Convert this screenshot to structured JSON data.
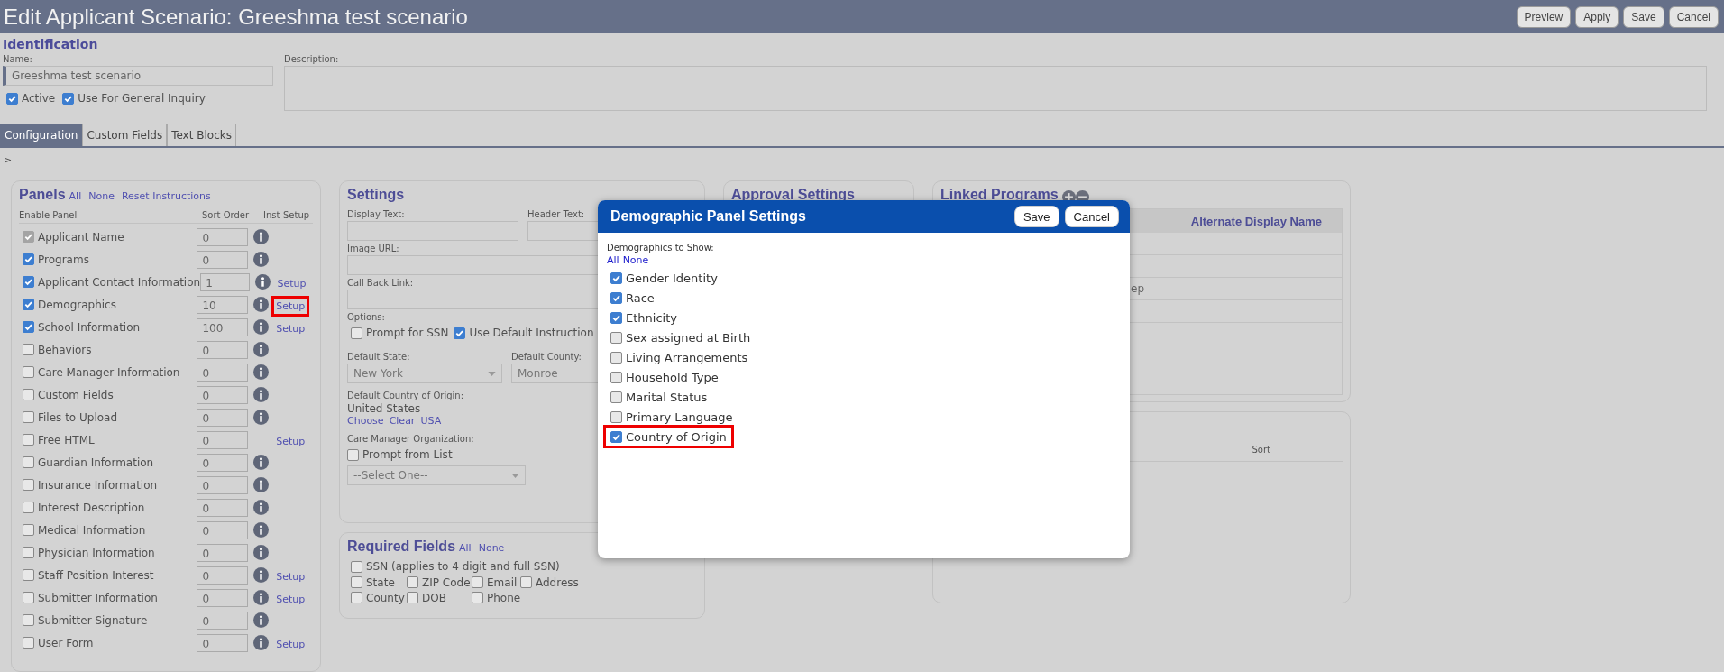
{
  "header": {
    "title": "Edit Applicant Scenario: Greeshma test scenario",
    "buttons": [
      "Preview",
      "Apply",
      "Save",
      "Cancel"
    ]
  },
  "identification": {
    "heading": "Identification",
    "name_label": "Name:",
    "name_value": "Greeshma test scenario",
    "description_label": "Description:",
    "options": [
      {
        "label": "Active",
        "checked": true
      },
      {
        "label": "Use For General Inquiry",
        "checked": true
      }
    ]
  },
  "tabs": [
    {
      "label": "Configuration",
      "selected": true
    },
    {
      "label": "Custom Fields",
      "selected": false
    },
    {
      "label": "Text Blocks",
      "selected": false
    }
  ],
  "breadcrumb": ">",
  "panels": {
    "heading": "Panels",
    "links": [
      "All",
      "None",
      "Reset Instructions"
    ],
    "columns": [
      "Enable Panel",
      "Sort Order",
      "Inst",
      "Setup"
    ],
    "rows": [
      {
        "name": "Applicant Name",
        "checked": true,
        "disabled": true,
        "sort": "0",
        "info": true
      },
      {
        "name": "Programs",
        "checked": true,
        "disabled": false,
        "sort": "0",
        "info": true
      },
      {
        "name": "Applicant Contact Information",
        "checked": true,
        "disabled": false,
        "sort": "1",
        "info": true,
        "setup": "Setup"
      },
      {
        "name": "Demographics",
        "checked": true,
        "disabled": false,
        "sort": "10",
        "info": true,
        "setup": "Setup",
        "highlighted": true
      },
      {
        "name": "School Information",
        "checked": true,
        "disabled": false,
        "sort": "100",
        "info": true,
        "setup": "Setup"
      },
      {
        "name": "Behaviors",
        "checked": false,
        "disabled": false,
        "sort": "0",
        "info": true
      },
      {
        "name": "Care Manager Information",
        "checked": false,
        "disabled": false,
        "sort": "0",
        "info": true
      },
      {
        "name": "Custom Fields",
        "checked": false,
        "disabled": false,
        "sort": "0",
        "info": true
      },
      {
        "name": "Files to Upload",
        "checked": false,
        "disabled": false,
        "sort": "0",
        "info": true
      },
      {
        "name": "Free HTML",
        "checked": false,
        "disabled": false,
        "sort": "0",
        "info": false,
        "setup": "Setup"
      },
      {
        "name": "Guardian Information",
        "checked": false,
        "disabled": false,
        "sort": "0",
        "info": true
      },
      {
        "name": "Insurance Information",
        "checked": false,
        "disabled": false,
        "sort": "0",
        "info": true
      },
      {
        "name": "Interest Description",
        "checked": false,
        "disabled": false,
        "sort": "0",
        "info": true
      },
      {
        "name": "Medical Information",
        "checked": false,
        "disabled": false,
        "sort": "0",
        "info": true
      },
      {
        "name": "Physician Information",
        "checked": false,
        "disabled": false,
        "sort": "0",
        "info": true
      },
      {
        "name": "Staff Position Interest",
        "checked": false,
        "disabled": false,
        "sort": "0",
        "info": true,
        "setup": "Setup"
      },
      {
        "name": "Submitter Information",
        "checked": false,
        "disabled": false,
        "sort": "0",
        "info": true,
        "setup": "Setup"
      },
      {
        "name": "Submitter Signature",
        "checked": false,
        "disabled": false,
        "sort": "0",
        "info": true
      },
      {
        "name": "User Form",
        "checked": false,
        "disabled": false,
        "sort": "0",
        "info": true,
        "setup": "Setup"
      }
    ]
  },
  "settings": {
    "heading": "Settings",
    "display_text_label": "Display Text:",
    "header_text_label": "Header Text:",
    "image_url_label": "Image URL:",
    "call_back_label": "Call Back Link:",
    "options_label": "Options:",
    "options": [
      {
        "label": "Prompt for SSN",
        "checked": false
      },
      {
        "label": "Use Default Instruction",
        "checked": true
      }
    ],
    "state_label": "Default State:",
    "state_value": "New York",
    "county_label": "Default County:",
    "county_value": "Monroe",
    "country_label": "Default Country of Origin:",
    "country_value": "United States",
    "country_links": [
      "Choose",
      "Clear",
      "USA"
    ],
    "care_label": "Care Manager Organization:",
    "care_option": {
      "label": "Prompt from List",
      "checked": false
    },
    "care_select": "--Select One--"
  },
  "required_fields": {
    "heading": "Required Fields",
    "links": [
      "All",
      "None"
    ],
    "rows": [
      [
        {
          "label": "SSN (applies to 4 digit and full SSN)",
          "checked": false
        }
      ],
      [
        {
          "label": "State",
          "checked": false
        },
        {
          "label": "ZIP Code",
          "checked": false
        },
        {
          "label": "Email",
          "checked": false
        },
        {
          "label": "Address",
          "checked": false
        }
      ],
      [
        {
          "label": "County",
          "checked": false
        },
        {
          "label": "DOB",
          "checked": false
        },
        {
          "label": "Phone",
          "checked": false
        }
      ]
    ]
  },
  "approval": {
    "heading": "Approval Settings"
  },
  "linked_programs": {
    "heading": "Linked Programs",
    "column_header": "Alternate Display Name",
    "partial_cell": "ep"
  },
  "list_box": {
    "column_header": "Sort"
  },
  "modal": {
    "title": "Demographic Panel Settings",
    "buttons": [
      "Save",
      "Cancel"
    ],
    "label": "Demographics to Show:",
    "links": [
      "All",
      "None"
    ],
    "items": [
      {
        "label": "Gender Identity",
        "checked": true,
        "highlighted": false
      },
      {
        "label": "Race",
        "checked": true,
        "highlighted": false
      },
      {
        "label": "Ethnicity",
        "checked": true,
        "highlighted": false
      },
      {
        "label": "Sex assigned at Birth",
        "checked": false,
        "highlighted": false
      },
      {
        "label": "Living Arrangements",
        "checked": false,
        "highlighted": false
      },
      {
        "label": "Household Type",
        "checked": false,
        "highlighted": false
      },
      {
        "label": "Marital Status",
        "checked": false,
        "highlighted": false
      },
      {
        "label": "Primary Language",
        "checked": false,
        "highlighted": false
      },
      {
        "label": "Country of Origin",
        "checked": true,
        "highlighted": true
      }
    ]
  }
}
